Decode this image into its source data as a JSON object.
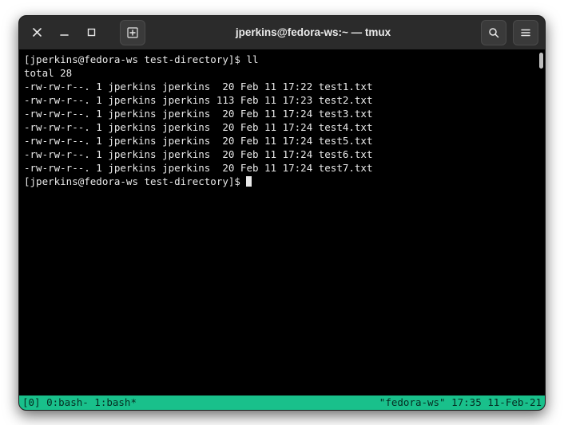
{
  "titlebar": {
    "title": "jperkins@fedora-ws:~ — tmux"
  },
  "terminal": {
    "prompt_prefix": "[jperkins@fedora-ws test-directory]$",
    "command": "ll",
    "total_line": "total 28",
    "rows": [
      {
        "perm": "-rw-rw-r--.",
        "links": "1",
        "owner": "jperkins",
        "group": "jperkins",
        "size": " 20",
        "date": "Feb 11 17:22",
        "name": "test1.txt"
      },
      {
        "perm": "-rw-rw-r--.",
        "links": "1",
        "owner": "jperkins",
        "group": "jperkins",
        "size": "113",
        "date": "Feb 11 17:23",
        "name": "test2.txt"
      },
      {
        "perm": "-rw-rw-r--.",
        "links": "1",
        "owner": "jperkins",
        "group": "jperkins",
        "size": " 20",
        "date": "Feb 11 17:24",
        "name": "test3.txt"
      },
      {
        "perm": "-rw-rw-r--.",
        "links": "1",
        "owner": "jperkins",
        "group": "jperkins",
        "size": " 20",
        "date": "Feb 11 17:24",
        "name": "test4.txt"
      },
      {
        "perm": "-rw-rw-r--.",
        "links": "1",
        "owner": "jperkins",
        "group": "jperkins",
        "size": " 20",
        "date": "Feb 11 17:24",
        "name": "test5.txt"
      },
      {
        "perm": "-rw-rw-r--.",
        "links": "1",
        "owner": "jperkins",
        "group": "jperkins",
        "size": " 20",
        "date": "Feb 11 17:24",
        "name": "test6.txt"
      },
      {
        "perm": "-rw-rw-r--.",
        "links": "1",
        "owner": "jperkins",
        "group": "jperkins",
        "size": " 20",
        "date": "Feb 11 17:24",
        "name": "test7.txt"
      }
    ]
  },
  "tmux": {
    "left": "[0] 0:bash- 1:bash*",
    "right": "\"fedora-ws\" 17:35 11-Feb-21"
  },
  "colors": {
    "tmux_bar_bg": "#19c08b",
    "terminal_bg": "#000000",
    "titlebar_bg": "#2b2b2b",
    "text": "#e9e9e9"
  }
}
